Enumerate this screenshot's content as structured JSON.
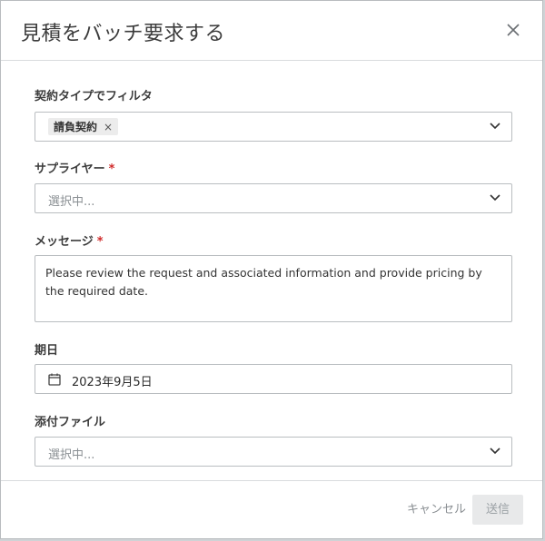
{
  "dialog": {
    "title": "見積をバッチ要求する"
  },
  "form": {
    "contract_filter": {
      "label": "契約タイプでフィルタ",
      "chip": "請負契約",
      "chip_remove": "×"
    },
    "supplier": {
      "label": "サプライヤー",
      "required_mark": "*",
      "placeholder": "選択中..."
    },
    "message": {
      "label": "メッセージ",
      "required_mark": "*",
      "value": "Please review the request and associated information and provide pricing by the required date."
    },
    "due_date": {
      "label": "期日",
      "value": "2023年9月5日"
    },
    "attachments": {
      "label": "添付ファイル",
      "placeholder": "選択中..."
    }
  },
  "footer": {
    "cancel_label": "キャンセル",
    "send_label": "送信"
  },
  "icons": {
    "close": "close-icon",
    "chevron": "chevron-down-icon",
    "calendar": "calendar-icon"
  },
  "colors": {
    "required": "#d02a2a",
    "disabled_button_bg": "#e8e9ea"
  }
}
